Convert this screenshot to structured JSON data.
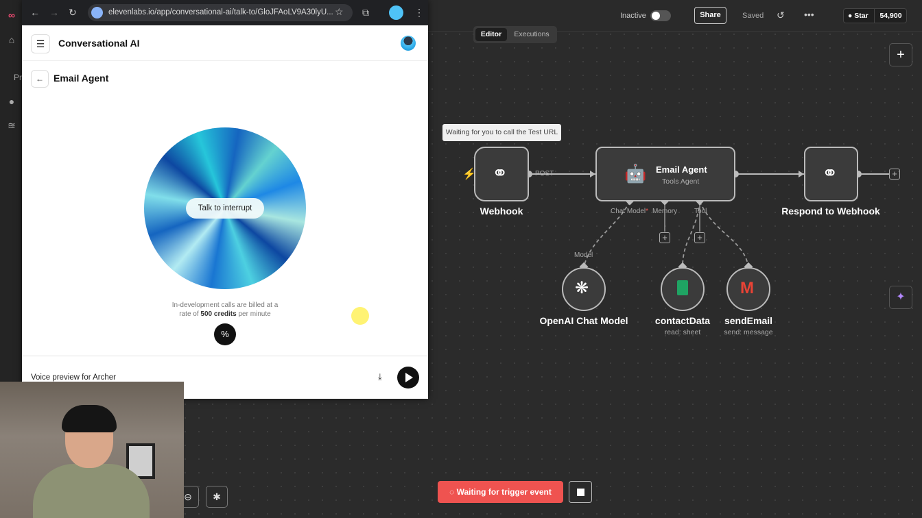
{
  "browser": {
    "url": "elevenlabs.io/app/conversational-ai/talk-to/GloJFAoLV9A30lyU...",
    "app_title": "Conversational AI",
    "agent_title": "Email Agent",
    "talk_pill": "Talk to interrupt",
    "billing_line1": "In-development calls are billed at a",
    "billing_prefix": "rate of ",
    "billing_bold": "500 credits",
    "billing_suffix": " per minute",
    "voice_preview": "Voice preview for Archer"
  },
  "n8n": {
    "status_label": "Inactive",
    "share_label": "Share",
    "saved_label": "Saved",
    "star_label": "Star",
    "star_count": "54,900",
    "tab_editor": "Editor",
    "tab_executions": "Executions",
    "tooltip": "Waiting for you to call the Test URL",
    "trigger_label": "Waiting for trigger event",
    "nodes": {
      "webhook": "Webhook",
      "post": "POST",
      "email_agent": "Email Agent",
      "email_agent_sub": "Tools Agent",
      "respond": "Respond to Webhook",
      "chat_model_port": "Chat Model",
      "chat_model_required": "*",
      "memory_port": "Memory",
      "tool_port": "Tool",
      "model_port": "Model",
      "openai": "OpenAI Chat Model",
      "contact": "contactData",
      "contact_sub": "read: sheet",
      "send": "sendEmail",
      "send_sub": "send: message"
    },
    "left_rail_text": "Pr"
  },
  "colors": {
    "trigger_bg": "#ef5350",
    "n8n_logo": "#ea4b71",
    "sheets_green": "#1fa463",
    "required_star": "#ef5350"
  }
}
